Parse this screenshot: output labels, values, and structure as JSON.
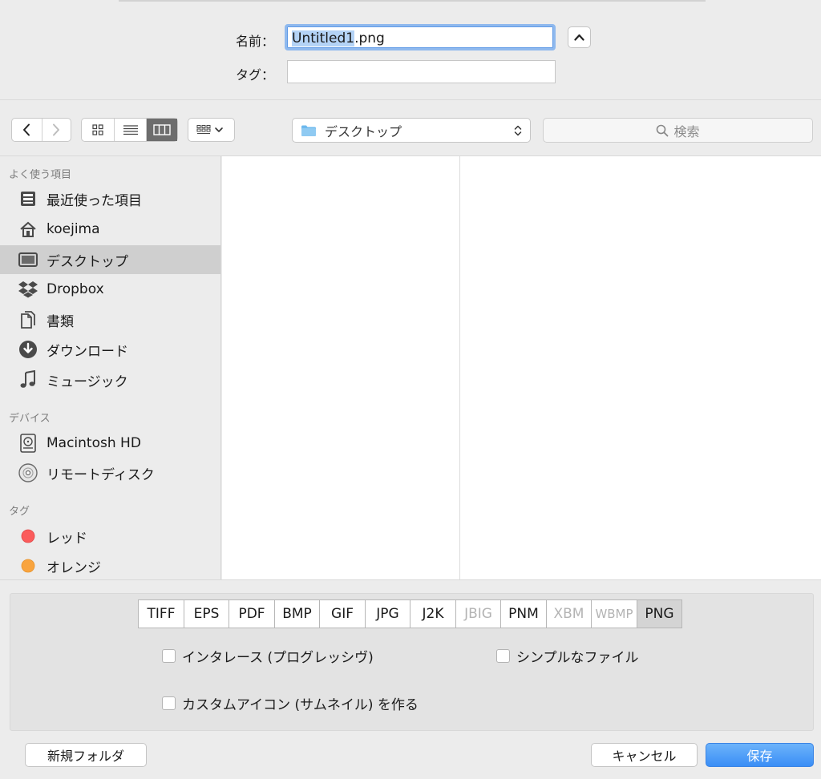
{
  "header": {
    "name_label": "名前：",
    "name_selected": "Untitled1",
    "name_rest": ".png",
    "tag_label": "タグ：",
    "tag_value": ""
  },
  "toolbar": {
    "location": "デスクトップ",
    "search_placeholder": "検索"
  },
  "sidebar": {
    "favorites_heading": "よく使う項目",
    "favorites": [
      {
        "label": "最近使った項目",
        "icon": "recents-icon"
      },
      {
        "label": "koejima",
        "icon": "home-icon"
      },
      {
        "label": "デスクトップ",
        "icon": "desktop-icon",
        "selected": true
      },
      {
        "label": "Dropbox",
        "icon": "dropbox-icon"
      },
      {
        "label": "書類",
        "icon": "documents-icon"
      },
      {
        "label": "ダウンロード",
        "icon": "downloads-icon"
      },
      {
        "label": "ミュージック",
        "icon": "music-icon"
      }
    ],
    "devices_heading": "デバイス",
    "devices": [
      {
        "label": "Macintosh HD",
        "icon": "harddisk-icon"
      },
      {
        "label": "リモートディスク",
        "icon": "disc-icon"
      }
    ],
    "tags_heading": "タグ",
    "tags": [
      {
        "label": "レッド",
        "color": "#fb5b5b"
      },
      {
        "label": "オレンジ",
        "color": "#f9a43e"
      }
    ]
  },
  "formats": {
    "items": [
      "TIFF",
      "EPS",
      "PDF",
      "BMP",
      "GIF",
      "JPG",
      "J2K",
      "JBIG",
      "PNM",
      "XBM",
      "WBMP",
      "PNG"
    ],
    "disabled": [
      "JBIG",
      "XBM",
      "WBMP"
    ],
    "selected": "PNG"
  },
  "options": {
    "interlace": "インタレース (プログレッシヴ)",
    "simple_file": "シンプルなファイル",
    "custom_icon": "カスタムアイコン (サムネイル) を作る"
  },
  "buttons": {
    "new_folder": "新規フォルダ",
    "cancel": "キャンセル",
    "save": "保存"
  },
  "colors": {
    "accent": "#3a8ef6",
    "selection": "#b4d3f6"
  }
}
